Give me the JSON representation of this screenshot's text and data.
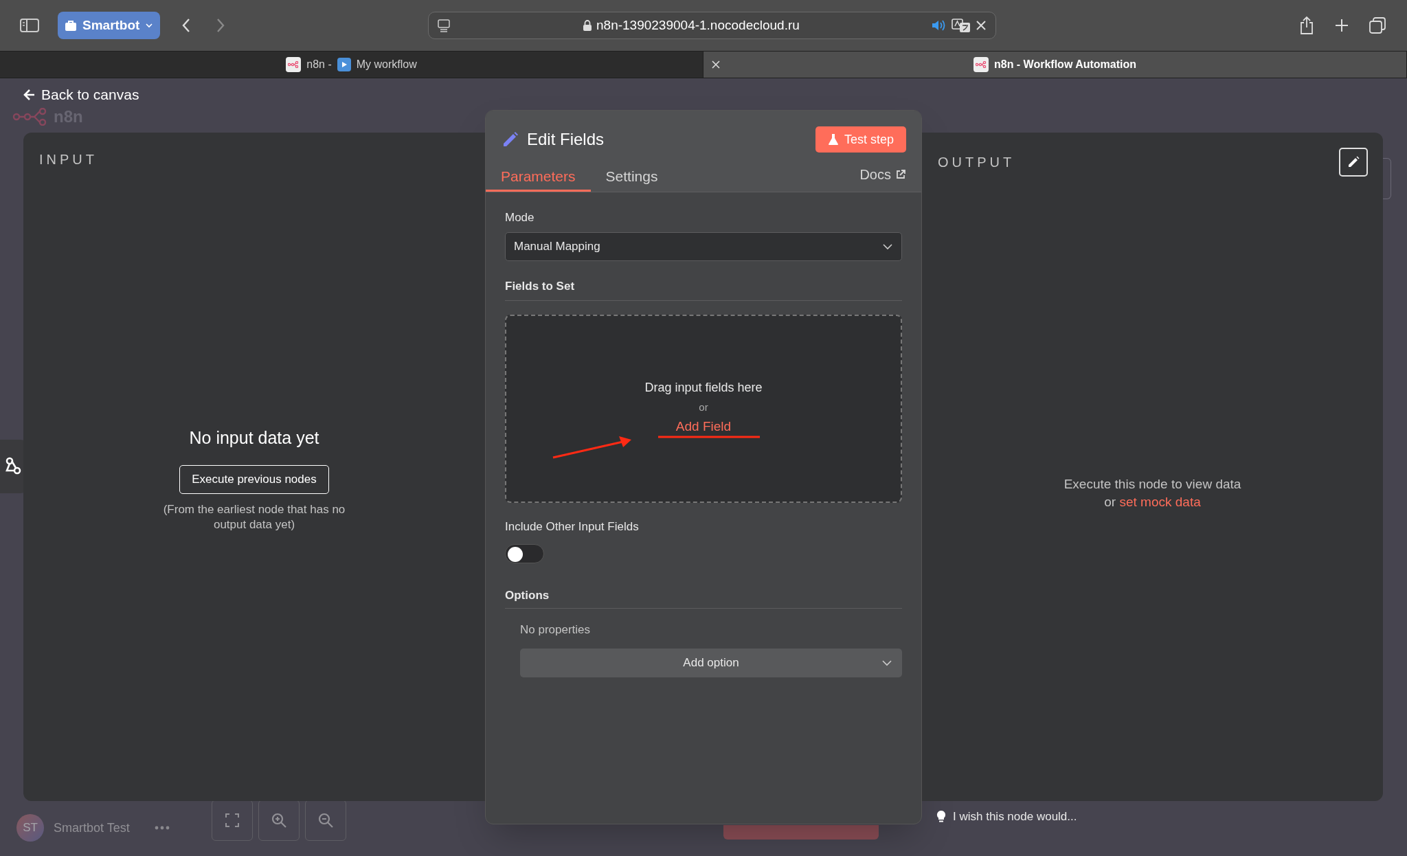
{
  "browser": {
    "profile": "Smartbot",
    "url": "n8n-1390239004-1.nocodecloud.ru",
    "tabs": [
      {
        "title_start": "n8n -",
        "title_end": "My workflow",
        "selected": false
      },
      {
        "title_start": "n8n - Workflow Automation",
        "selected": true
      }
    ]
  },
  "canvas": {
    "back_link": "Back to canvas",
    "logo": "n8n",
    "user": {
      "initials": "ST",
      "name": "Smartbot Test"
    },
    "hint": "I wish this node would..."
  },
  "input_panel": {
    "title": "INPUT",
    "empty_title": "No input data yet",
    "button": "Execute previous nodes",
    "note": "(From the earliest node that has no output data yet)"
  },
  "node": {
    "title": "Edit Fields",
    "test_button": "Test step",
    "tabs": [
      {
        "label": "Parameters",
        "selected": true
      },
      {
        "label": "Settings",
        "selected": false
      }
    ],
    "docs": "Docs",
    "mode": {
      "label": "Mode",
      "value": "Manual Mapping"
    },
    "fields_to_set": {
      "label": "Fields to Set",
      "drop_text": "Drag input fields here",
      "or": "or",
      "add_link": "Add Field"
    },
    "include_other": {
      "label": "Include Other Input Fields",
      "on": false
    },
    "options": {
      "label": "Options",
      "empty": "No properties",
      "add_button": "Add option"
    }
  },
  "output_panel": {
    "title": "OUTPUT",
    "message": "Execute this node to view data",
    "or": "or",
    "link": "set mock data"
  }
}
